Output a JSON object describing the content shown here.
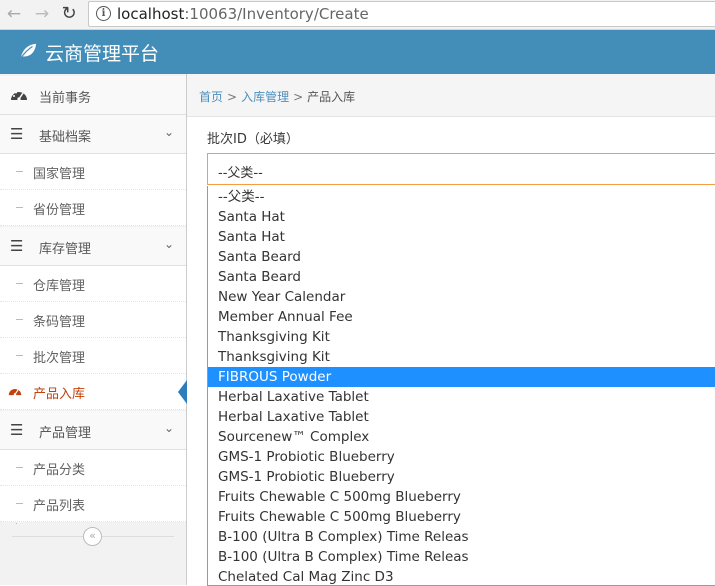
{
  "browser": {
    "url_host": "localhost",
    "url_path": ":10063/Inventory/Create"
  },
  "header": {
    "brand": "云商管理平台"
  },
  "sidebar": {
    "items": [
      {
        "label": "当前事务",
        "type": "top",
        "icon": "dashboard-icon"
      },
      {
        "label": "基础档案",
        "type": "group",
        "icon": "list-icon"
      },
      {
        "label": "国家管理",
        "type": "sub"
      },
      {
        "label": "省份管理",
        "type": "sub"
      },
      {
        "label": "库存管理",
        "type": "group",
        "icon": "list-icon"
      },
      {
        "label": "仓库管理",
        "type": "sub"
      },
      {
        "label": "条码管理",
        "type": "sub"
      },
      {
        "label": "批次管理",
        "type": "sub"
      },
      {
        "label": "产品入库",
        "type": "sub",
        "active": true,
        "icon": "dashboard-icon"
      },
      {
        "label": "产品管理",
        "type": "group",
        "icon": "list-icon"
      },
      {
        "label": "产品分类",
        "type": "sub"
      },
      {
        "label": "产品列表",
        "type": "sub"
      }
    ]
  },
  "breadcrumb": {
    "home": "首页",
    "parent": "入库管理",
    "current": "产品入库",
    "separator": ">"
  },
  "form": {
    "batch_label": "批次ID（必填）",
    "batch_value": "--父类--",
    "options": [
      "--父类--",
      "Santa Hat",
      "Santa Hat",
      "Santa Beard",
      "Santa Beard",
      "New Year Calendar",
      "Member Annual Fee",
      "Thanksgiving Kit",
      "Thanksgiving Kit",
      "FIBROUS Powder",
      "Herbal Laxative Tablet",
      "Herbal Laxative Tablet",
      "Sourcenew™ Complex",
      "GMS-1 Probiotic Blueberry",
      "GMS-1 Probiotic Blueberry",
      "Fruits Chewable C 500mg Blueberry",
      "Fruits Chewable C 500mg Blueberry",
      "B-100 (Ultra B Complex) Time Releas",
      "B-100 (Ultra B Complex) Time Releas",
      "Chelated Cal Mag Zinc D3"
    ],
    "highlighted_index": 9
  },
  "colors": {
    "header": "#438eb9",
    "highlight": "#1e90ff",
    "focus_border": "#f0a040"
  }
}
